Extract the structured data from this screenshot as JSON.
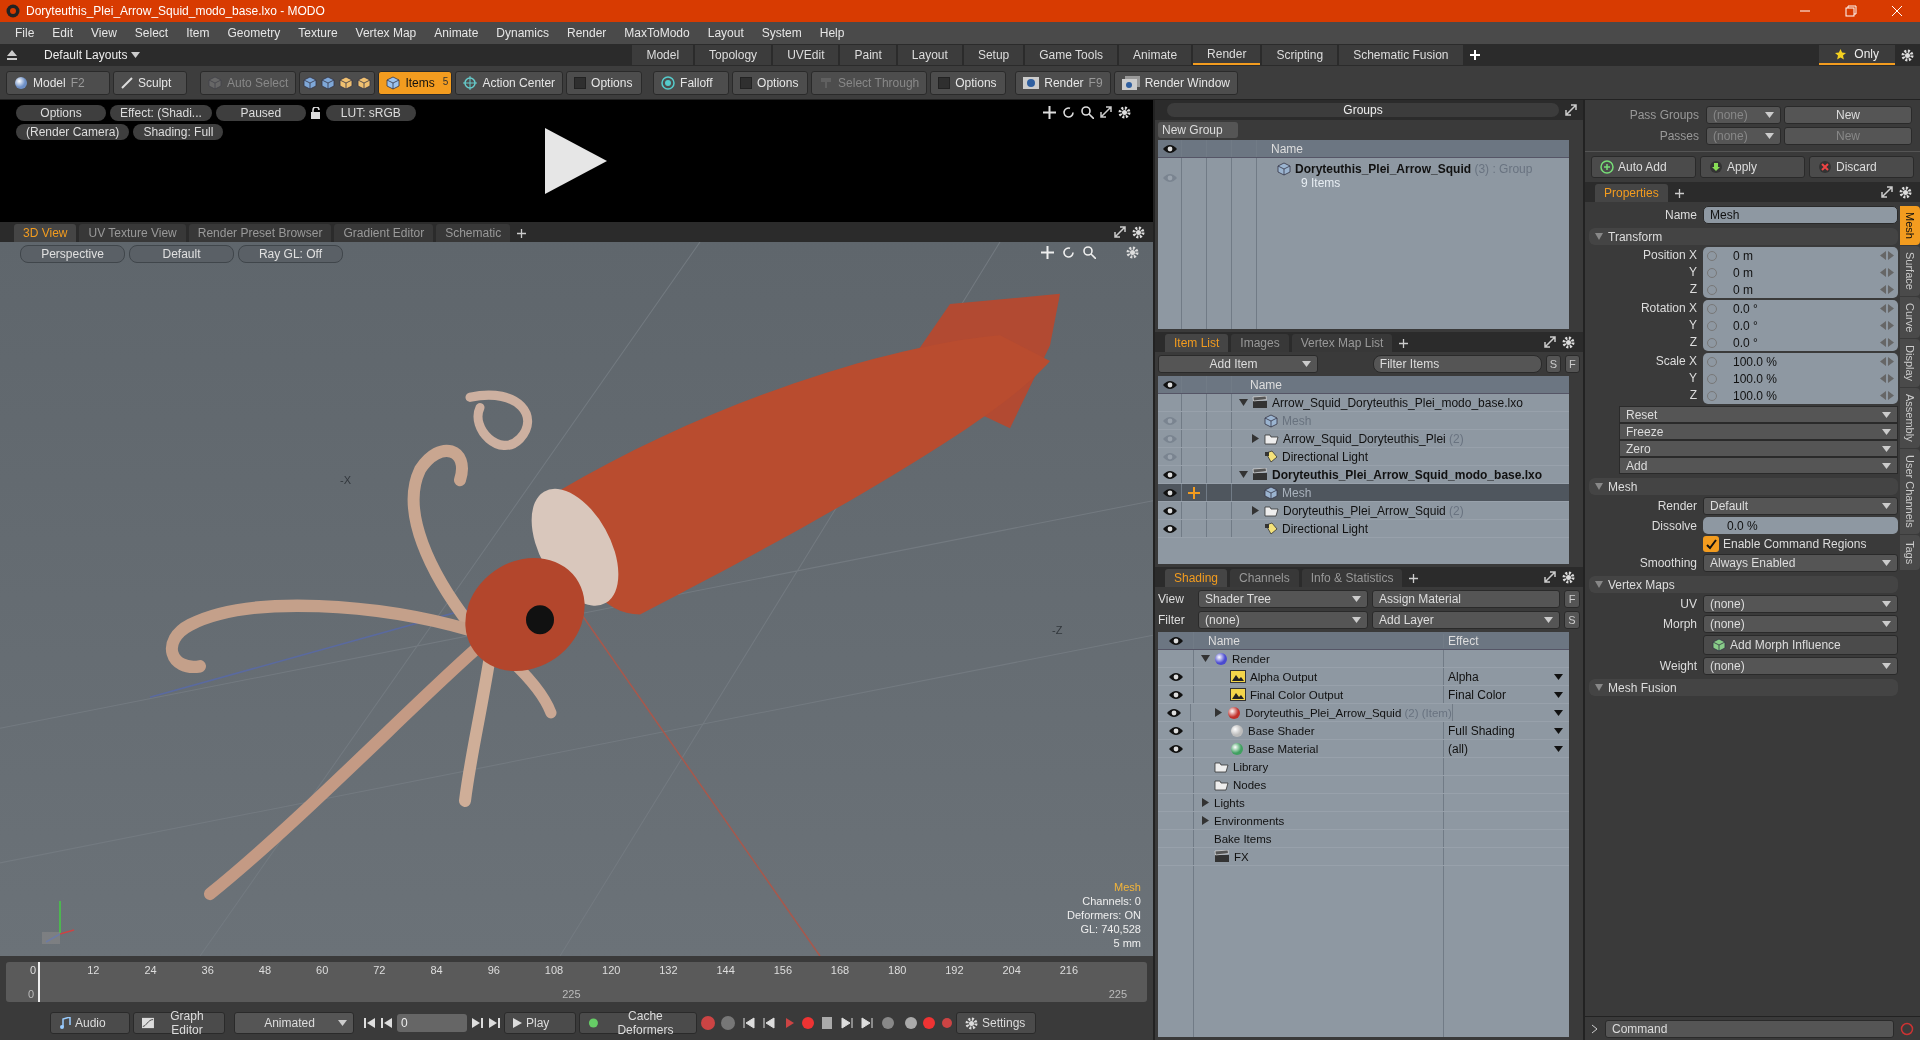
{
  "window": {
    "title": "Doryteuthis_Plei_Arrow_Squid_modo_base.lxo - MODO"
  },
  "menu": [
    "File",
    "Edit",
    "View",
    "Select",
    "Item",
    "Geometry",
    "Texture",
    "Vertex Map",
    "Animate",
    "Dynamics",
    "Render",
    "MaxToModo",
    "Layout",
    "System",
    "Help"
  ],
  "layouts": {
    "label": "Default Layouts"
  },
  "layout_tabs": [
    {
      "label": "Model",
      "selected": false
    },
    {
      "label": "Topology",
      "selected": false
    },
    {
      "label": "UVEdit",
      "selected": false
    },
    {
      "label": "Paint",
      "selected": false
    },
    {
      "label": "Layout",
      "selected": false
    },
    {
      "label": "Setup",
      "selected": false
    },
    {
      "label": "Game Tools",
      "selected": false
    },
    {
      "label": "Animate",
      "selected": false
    },
    {
      "label": "Render",
      "selected": true
    },
    {
      "label": "Scripting",
      "selected": false
    },
    {
      "label": "Schematic Fusion",
      "selected": false
    }
  ],
  "only_button": {
    "label": "Only"
  },
  "toolbar": [
    {
      "kind": "mode",
      "label": "Model",
      "shortcut": "F2",
      "selected": false,
      "disabled": false
    },
    {
      "kind": "sculpt",
      "label": "Sculpt",
      "selected": false,
      "disabled": false
    },
    {
      "kind": "auto-select",
      "label": "Auto Select",
      "selected": false,
      "disabled": true
    },
    {
      "kind": "select-icons",
      "selected": false,
      "disabled": false
    },
    {
      "kind": "items",
      "label": "Items",
      "badge": "5",
      "selected": true,
      "disabled": false
    },
    {
      "kind": "action-center",
      "label": "Action Center",
      "selected": false,
      "disabled": false
    },
    {
      "kind": "options",
      "label": "Options",
      "selected": false,
      "disabled": false
    },
    {
      "kind": "falloff",
      "label": "Falloff",
      "selected": false,
      "disabled": false
    },
    {
      "kind": "options",
      "label": "Options",
      "selected": false,
      "disabled": false
    },
    {
      "kind": "select-through",
      "label": "Select Through",
      "selected": false,
      "disabled": true
    },
    {
      "kind": "options",
      "label": "Options",
      "selected": false,
      "disabled": false
    },
    {
      "kind": "render",
      "label": "Render",
      "shortcut": "F9",
      "selected": false,
      "disabled": false
    },
    {
      "kind": "render-window",
      "label": "Render Window",
      "selected": false,
      "disabled": false
    }
  ],
  "preview": {
    "rows": [
      [
        "Options",
        "Effect: (Shadi...",
        "Paused",
        "LUT: sRGB"
      ],
      [
        "(Render Camera)",
        "Shading: Full"
      ]
    ]
  },
  "viewport": {
    "tabs": [
      {
        "label": "3D View",
        "selected": true
      },
      {
        "label": "UV Texture View",
        "selected": false
      },
      {
        "label": "Render Preset Browser",
        "selected": false
      },
      {
        "label": "Gradient Editor",
        "selected": false
      },
      {
        "label": "Schematic",
        "selected": false
      }
    ],
    "buttons": [
      "Perspective",
      "Default",
      "Ray GL: Off"
    ],
    "axis_labels": [
      "-X",
      "-Z"
    ],
    "info_title": "Mesh",
    "info": [
      "Channels: 0",
      "Deformers: ON",
      "GL: 740,528",
      "5 mm"
    ]
  },
  "timeline": {
    "ticks": [
      "0",
      "12",
      "24",
      "36",
      "48",
      "60",
      "72",
      "84",
      "96",
      "108",
      "120",
      "132",
      "144",
      "156",
      "168",
      "180",
      "192",
      "204",
      "216"
    ],
    "sub_ticks": [
      "0",
      "225",
      "225"
    ]
  },
  "bottom_bar": {
    "audio": "Audio",
    "graph_editor": "Graph Editor",
    "mode": "Animated",
    "frame": "0",
    "play": "Play",
    "cache": "Cache Deformers",
    "settings": "Settings"
  },
  "groups": {
    "title": "Groups",
    "new_button": "New Group",
    "column": "Name",
    "rows": [
      {
        "name": "Doryteuthis_Plei_Arrow_Squid",
        "count": "(3)",
        "type": ": Group",
        "detail": "9 Items"
      }
    ]
  },
  "item_list": {
    "tabs": [
      {
        "label": "Item List",
        "selected": true
      },
      {
        "label": "Images",
        "selected": false
      },
      {
        "label": "Vertex Map List",
        "selected": false
      }
    ],
    "add_item": "Add Item",
    "filter": {
      "placeholder": "Filter Items"
    },
    "s": "S",
    "f": "F",
    "column": "Name",
    "rows": [
      {
        "kind": "scene",
        "label": "Arrow_Squid_Doryteuthis_Plei_modo_base.lxo",
        "current": false,
        "expanded": true,
        "selected": false,
        "children": [
          {
            "kind": "mesh",
            "label": "Mesh",
            "visible": false,
            "selected": false
          },
          {
            "kind": "group",
            "label": "Arrow_Squid_Doryteuthis_Plei",
            "count": "(2)",
            "expanded": false,
            "visible": false,
            "selected": false
          },
          {
            "kind": "light",
            "label": "Directional Light",
            "visible": false,
            "selected": false
          }
        ]
      },
      {
        "kind": "scene",
        "label": "Doryteuthis_Plei_Arrow_Squid_modo_base.lxo",
        "current": true,
        "expanded": true,
        "visible": true,
        "selected": false,
        "children": [
          {
            "kind": "mesh",
            "label": "Mesh",
            "visible": true,
            "selected": true
          },
          {
            "kind": "group",
            "label": "Doryteuthis_Plei_Arrow_Squid",
            "count": "(2)",
            "expanded": false,
            "visible": true,
            "selected": false
          },
          {
            "kind": "light",
            "label": "Directional Light",
            "visible": true,
            "selected": false
          }
        ]
      }
    ]
  },
  "shading": {
    "tabs": [
      {
        "label": "Shading",
        "selected": true
      },
      {
        "label": "Channels",
        "selected": false
      },
      {
        "label": "Info & Statistics",
        "selected": false
      }
    ],
    "view_label": "View",
    "view": "Shader Tree",
    "assign": "Assign Material",
    "f": "F",
    "filter_label": "Filter",
    "filter": "(none)",
    "add_layer": "Add Layer",
    "s": "S",
    "columns": [
      "Name",
      "Effect"
    ],
    "rows": [
      {
        "kind": "render",
        "label": "Render",
        "expanded": true,
        "children": [
          {
            "kind": "output",
            "label": "Alpha Output",
            "effect": "Alpha"
          },
          {
            "kind": "output",
            "label": "Final Color Output",
            "effect": "Final Color"
          },
          {
            "kind": "material-group",
            "label": "Doryteuthis_Plei_Arrow_Squid",
            "count": "(2) (Item)",
            "expanded": false
          },
          {
            "kind": "shader",
            "label": "Base Shader",
            "effect": "Full Shading"
          },
          {
            "kind": "material",
            "label": "Base Material",
            "effect": "(all)"
          }
        ]
      },
      {
        "kind": "folder",
        "label": "Library"
      },
      {
        "kind": "folder",
        "label": "Nodes"
      },
      {
        "kind": "category",
        "label": "Lights",
        "expanded": false
      },
      {
        "kind": "category",
        "label": "Environments",
        "expanded": false
      },
      {
        "kind": "category",
        "label": "Bake Items"
      },
      {
        "kind": "fx",
        "label": "FX"
      }
    ]
  },
  "passes": {
    "pass_groups": {
      "label": "Pass Groups",
      "value": "(none)",
      "button": {
        "label": "New",
        "disabled": false
      }
    },
    "passes": {
      "label": "Passes",
      "value": "(none)",
      "button": {
        "label": "New",
        "disabled": true
      }
    },
    "auto_add": "Auto Add",
    "apply": "Apply",
    "discard": "Discard"
  },
  "properties": {
    "tabs": [
      {
        "label": "Properties",
        "selected": true
      }
    ],
    "side_tabs": [
      {
        "label": "Mesh",
        "selected": true
      },
      {
        "label": "Surface",
        "selected": false
      },
      {
        "label": "Curve",
        "selected": false
      },
      {
        "label": "Display",
        "selected": false
      },
      {
        "label": "Assembly",
        "selected": false
      },
      {
        "label": "User Channels",
        "selected": false
      },
      {
        "label": "Tags",
        "selected": false
      }
    ],
    "name_label": "Name",
    "name": "Mesh",
    "sections": [
      {
        "title": "Transform",
        "fields": [
          {
            "kind": "vector",
            "rows": [
              {
                "label": "Position X",
                "value": "0 m"
              },
              {
                "label": "Y",
                "value": "0 m"
              },
              {
                "label": "Z",
                "value": "0 m"
              }
            ]
          },
          {
            "kind": "vector",
            "rows": [
              {
                "label": "Rotation X",
                "value": "0.0 °"
              },
              {
                "label": "Y",
                "value": "0.0 °"
              },
              {
                "label": "Z",
                "value": "0.0 °"
              }
            ]
          },
          {
            "kind": "vector",
            "rows": [
              {
                "label": "Scale X",
                "value": "100.0 %"
              },
              {
                "label": "Y",
                "value": "100.0 %"
              },
              {
                "label": "Z",
                "value": "100.0 %"
              }
            ]
          },
          {
            "kind": "actions",
            "items": [
              "Reset",
              "Freeze",
              "Zero",
              "Add"
            ]
          }
        ]
      },
      {
        "title": "Mesh",
        "fields": [
          {
            "kind": "dropdown",
            "label": "Render",
            "value": "Default"
          },
          {
            "kind": "number",
            "label": "Dissolve",
            "value": "0.0 %"
          },
          {
            "kind": "checkbox",
            "label": "Enable Command Regions",
            "checked": true
          },
          {
            "kind": "dropdown",
            "label": "Smoothing",
            "value": "Always Enabled"
          }
        ]
      },
      {
        "title": "Vertex Maps",
        "fields": [
          {
            "kind": "dropdown",
            "label": "UV",
            "value": "(none)"
          },
          {
            "kind": "dropdown",
            "label": "Morph",
            "value": "(none)"
          },
          {
            "kind": "button",
            "label": "Add Morph Influence"
          },
          {
            "kind": "dropdown",
            "label": "Weight",
            "value": "(none)"
          }
        ]
      },
      {
        "title": "Mesh Fusion"
      }
    ]
  },
  "command": {
    "placeholder": "Command"
  }
}
